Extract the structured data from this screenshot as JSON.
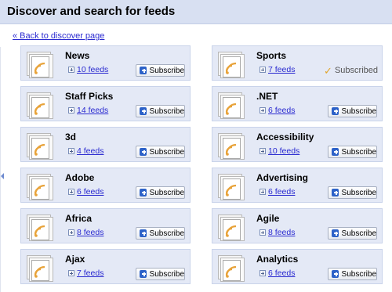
{
  "header": {
    "title": "Discover and search for feeds"
  },
  "back_link": "« Back to discover page",
  "subscribe_label": "Subscribe",
  "subscribed_label": "Subscribed",
  "feeds": [
    {
      "title": "News",
      "count": "10 feeds",
      "status": "subscribe"
    },
    {
      "title": "Sports",
      "count": "7 feeds",
      "status": "subscribed"
    },
    {
      "title": "Staff Picks",
      "count": "14 feeds",
      "status": "subscribe"
    },
    {
      "title": ".NET",
      "count": "6 feeds",
      "status": "subscribe"
    },
    {
      "title": "3d",
      "count": "4 feeds",
      "status": "subscribe"
    },
    {
      "title": "Accessibility",
      "count": "10 feeds",
      "status": "subscribe"
    },
    {
      "title": "Adobe",
      "count": "6 feeds",
      "status": "subscribe"
    },
    {
      "title": "Advertising",
      "count": "6 feeds",
      "status": "subscribe"
    },
    {
      "title": "Africa",
      "count": "8 feeds",
      "status": "subscribe"
    },
    {
      "title": "Agile",
      "count": "8 feeds",
      "status": "subscribe"
    },
    {
      "title": "Ajax",
      "count": "7 feeds",
      "status": "subscribe"
    },
    {
      "title": "Analytics",
      "count": "6 feeds",
      "status": "subscribe"
    }
  ],
  "colors": {
    "header_bg": "#d8e0f2",
    "card_bg": "#e4e9f6",
    "link": "#2a2ad0",
    "subscribe_icon": "#2d62c8",
    "check": "#e2a52b",
    "rss_orange": "#e8a33a"
  },
  "icons": {
    "feed": "feed-document-icon",
    "expand": "expand-plus-icon",
    "subscribe": "plus-icon",
    "subscribed": "checkmark-icon"
  }
}
